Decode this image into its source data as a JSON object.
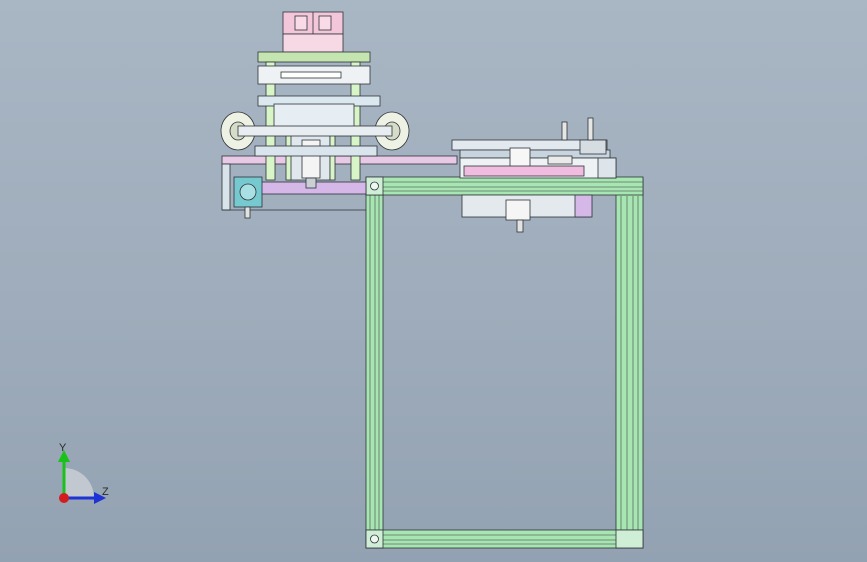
{
  "triad": {
    "y_label": "Y",
    "z_label": "Z",
    "colors": {
      "y": "#19c219",
      "z": "#1d33d6",
      "x": "#d41c1c"
    }
  },
  "colors": {
    "background": "#a3b0bf",
    "frame_green": "#a7e6b2",
    "frame_dark": "#3b4a3f",
    "cylinder_pink": "#f3c6d9",
    "rod_green": "#d8f5c8",
    "plate_lilac": "#d5b8e8",
    "plate_pink": "#f0bde0",
    "motor_teal": "#76c9cf",
    "edge": "#2e3338"
  }
}
